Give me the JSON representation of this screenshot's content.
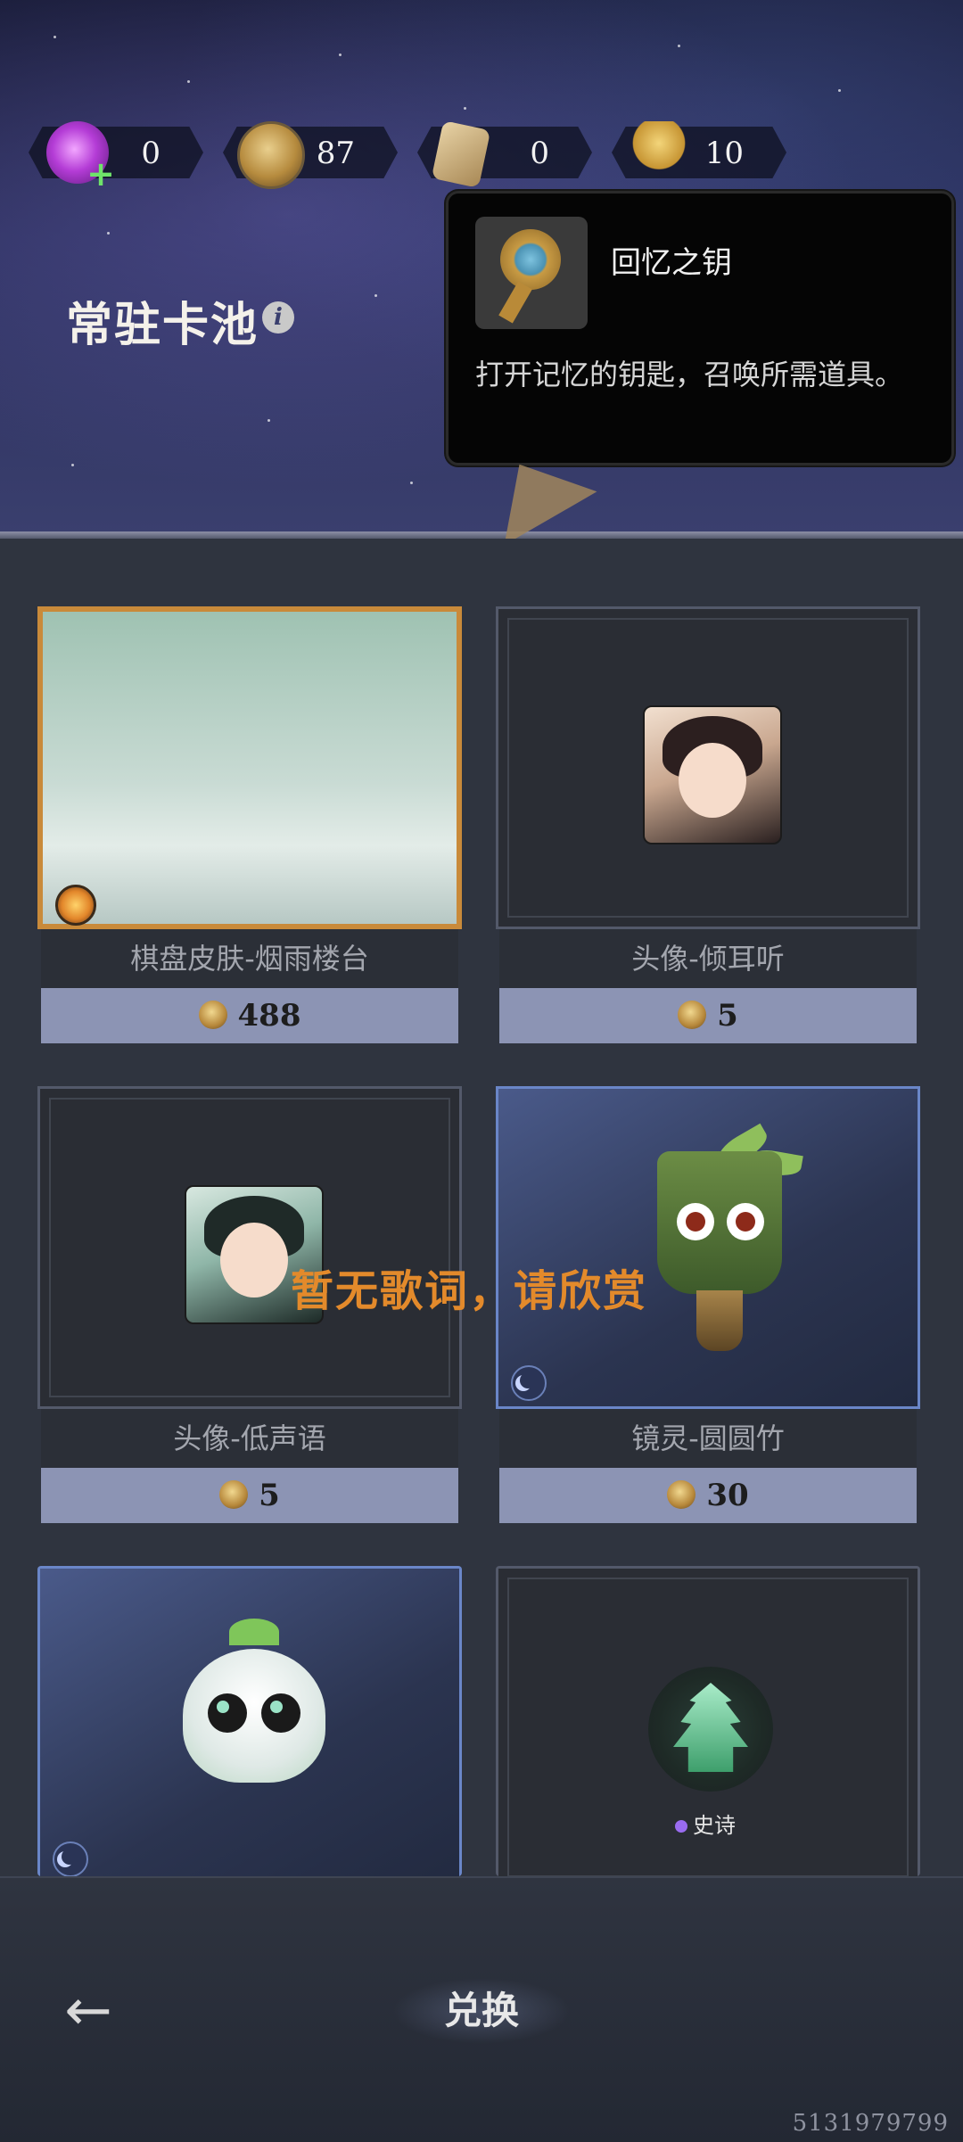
{
  "currencies": [
    {
      "name": "candy",
      "value": "0"
    },
    {
      "name": "coin",
      "value": "87"
    },
    {
      "name": "hourglass",
      "value": "0"
    },
    {
      "name": "memory-key",
      "value": "10"
    }
  ],
  "pool": {
    "title": "常驻卡池",
    "info_icon": "info-icon"
  },
  "tooltip": {
    "title": "回忆之钥",
    "description": "打开记忆的钥匙，召唤所需道具。"
  },
  "items": [
    {
      "name": "棋盘皮肤-烟雨楼台",
      "price": "488"
    },
    {
      "name": "头像-倾耳听",
      "price": "5"
    },
    {
      "name": "头像-低声语",
      "price": "5"
    },
    {
      "name": "镜灵-圆圆竹",
      "price": "30"
    },
    {
      "name": "",
      "price": ""
    },
    {
      "name": "",
      "price": ""
    }
  ],
  "epic_label": "史诗",
  "lyric_overlay": "暂无歌词，请欣赏",
  "bottom": {
    "back_icon": "back-arrow-icon",
    "exchange_label": "兑换"
  },
  "footer_id": "5131979799",
  "colors": {
    "gold_frame": "#c98a3a",
    "blue_frame": "#6a86c8",
    "price_bar": "#8c94b4",
    "lyric": "#e38a2b"
  }
}
